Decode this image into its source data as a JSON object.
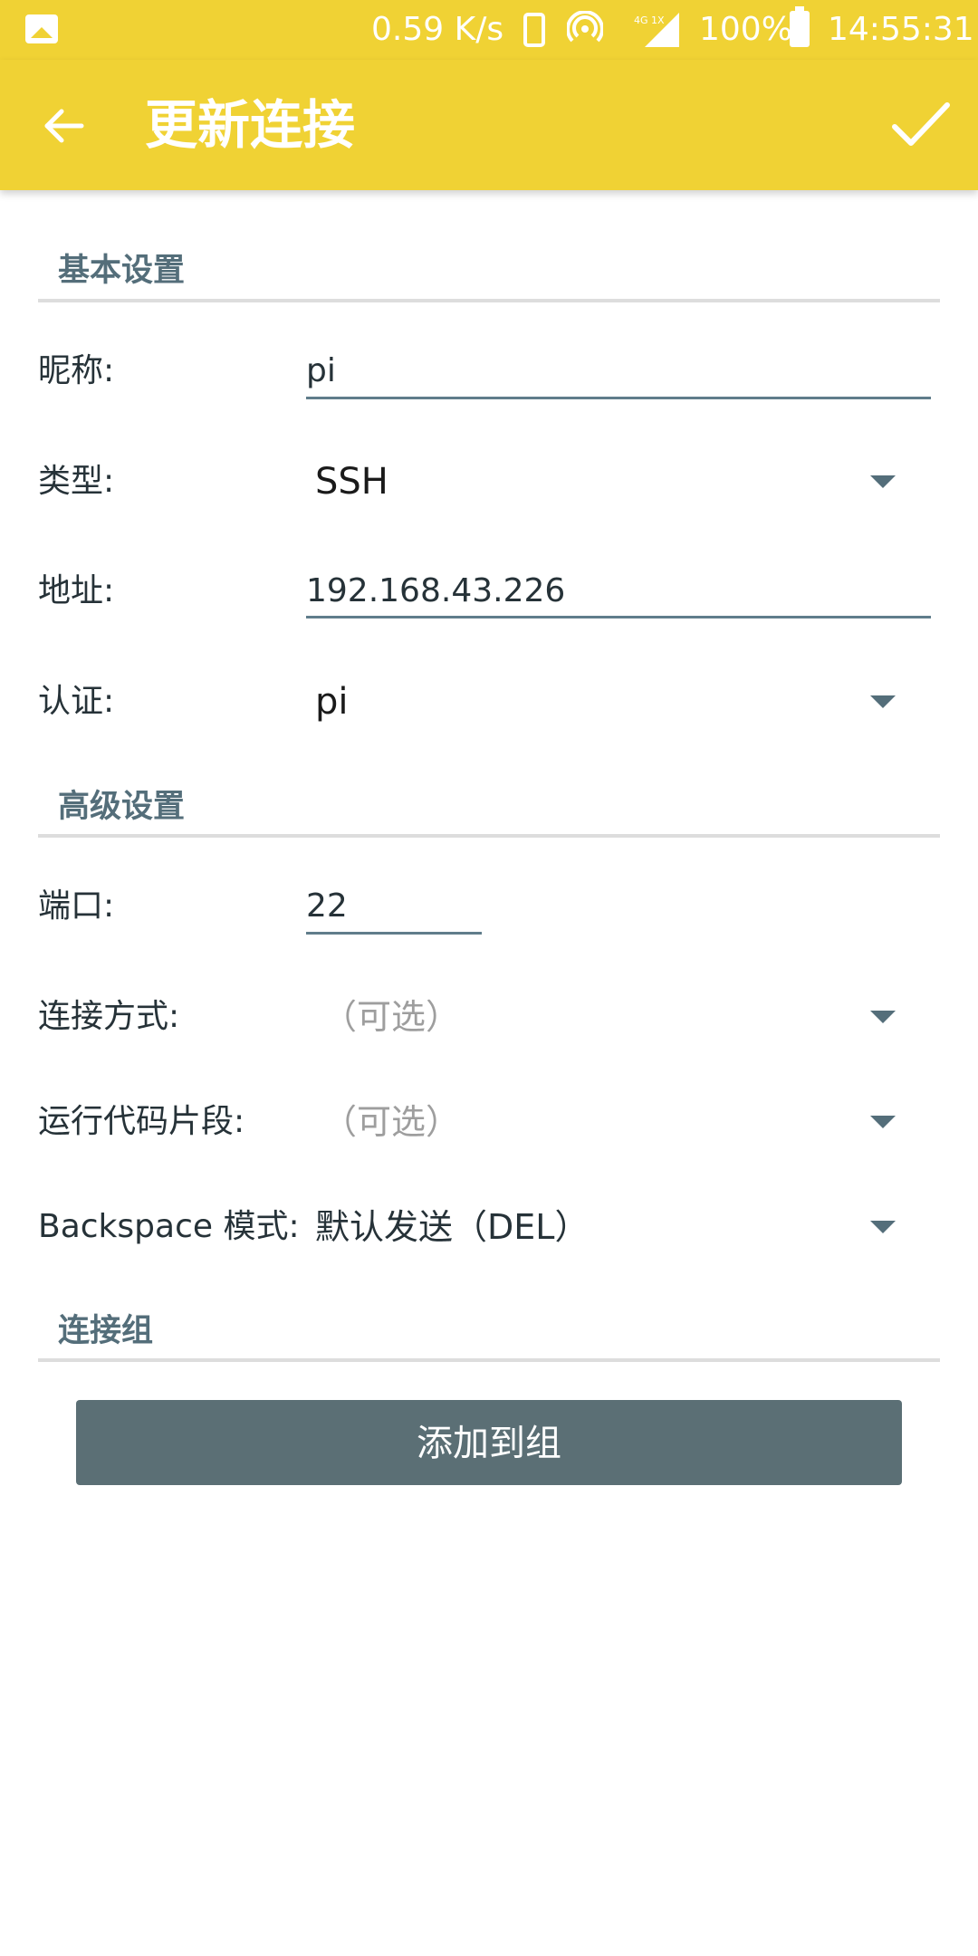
{
  "status_bar": {
    "speed": "0.59 K/s",
    "battery": "100%",
    "time": "14:55:31",
    "network_label": "4G 1X",
    "icons": [
      "gallery-icon",
      "phone-icon",
      "hotspot-icon",
      "signal-icon",
      "battery-icon"
    ]
  },
  "app_bar": {
    "title": "更新连接",
    "back_icon": "arrow-left-icon",
    "confirm_icon": "check-icon",
    "background": "#F0D234"
  },
  "basic_section": {
    "title": "基本设置",
    "nickname": {
      "label": "昵称:",
      "value": "pi"
    },
    "type": {
      "label": "类型:",
      "value": "SSH"
    },
    "address": {
      "label": "地址:",
      "value": "192.168.43.226"
    },
    "auth": {
      "label": "认证:",
      "value": "pi"
    }
  },
  "advanced_section": {
    "title": "高级设置",
    "port": {
      "label": "端口:",
      "value": "22"
    },
    "connection_method": {
      "label": "连接方式:",
      "value": "（可选）"
    },
    "snippet": {
      "label": "运行代码片段:",
      "value": "（可选）"
    },
    "backspace": {
      "label": "Backspace 模式:",
      "value": "默认发送（DEL）"
    }
  },
  "group_section": {
    "title": "连接组",
    "add_button": "添加到组"
  },
  "colors": {
    "accent": "#F0D234",
    "section_title": "#546E7A",
    "button": "#5B6F75"
  }
}
